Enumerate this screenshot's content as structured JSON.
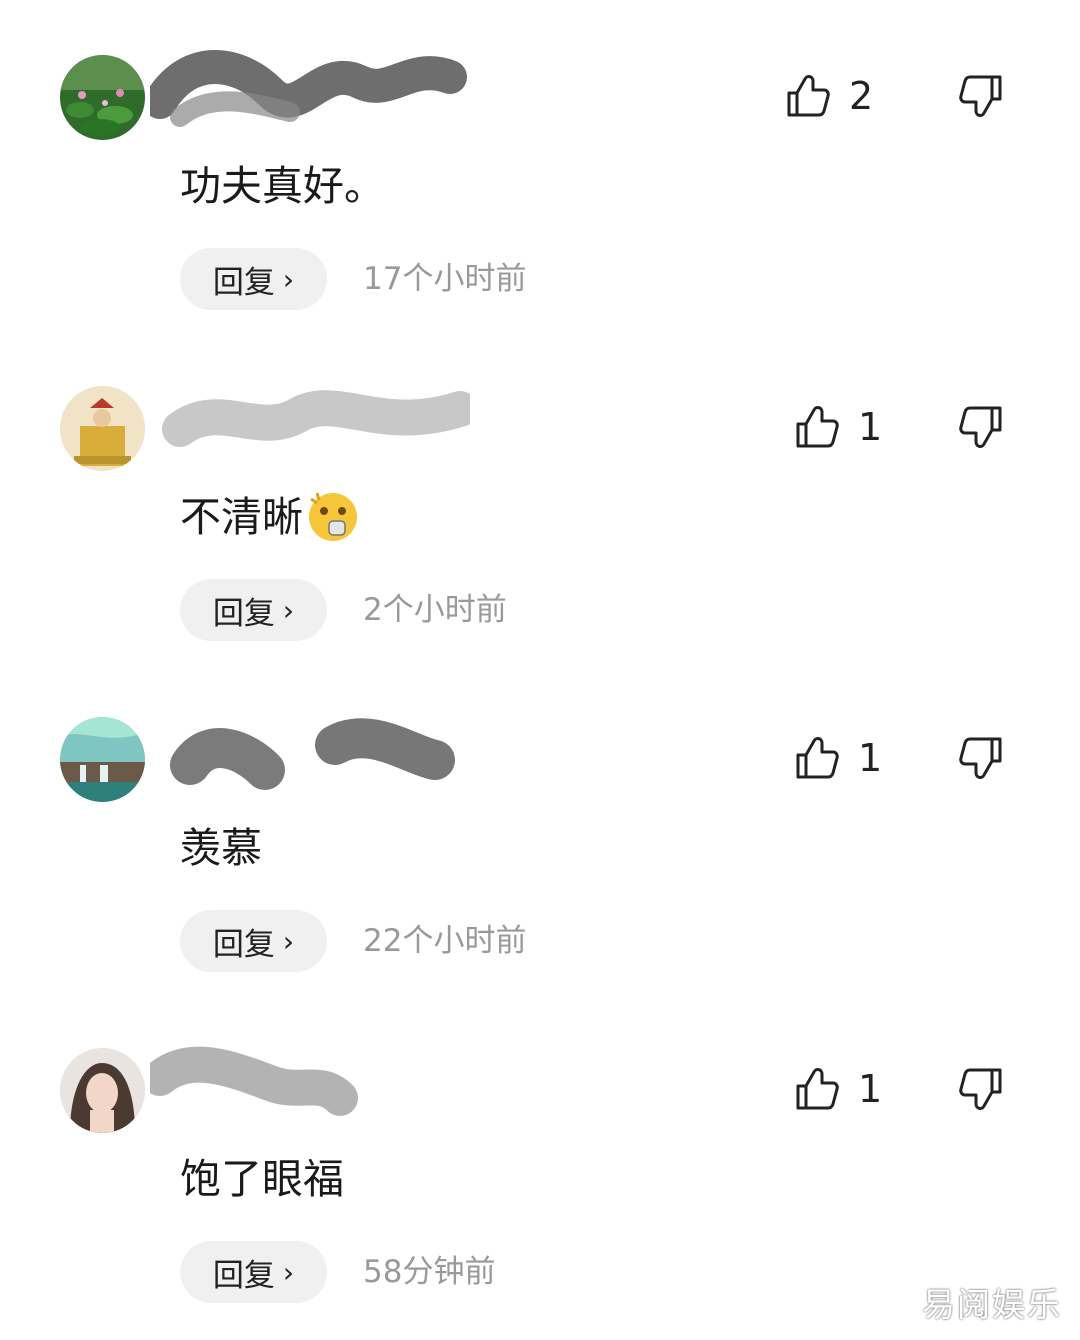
{
  "comments": [
    {
      "likes": "2",
      "text": "功夫真好。",
      "reply_label": "回复",
      "time": "17个小时前",
      "avatar_icon": "lotus-pond-avatar"
    },
    {
      "likes": "1",
      "text": "不清晰",
      "emoji_icon": "dizzy-face-emoji",
      "reply_label": "回复",
      "time": "2个小时前",
      "avatar_icon": "emperor-portrait-avatar"
    },
    {
      "likes": "1",
      "text": "羡慕",
      "reply_label": "回复",
      "time": "22个小时前",
      "avatar_icon": "aurora-waterfall-avatar"
    },
    {
      "likes": "1",
      "text": "饱了眼福",
      "reply_label": "回复",
      "time": "58分钟前",
      "avatar_icon": "woman-portrait-avatar"
    }
  ],
  "watermark": "易阅娱乐"
}
